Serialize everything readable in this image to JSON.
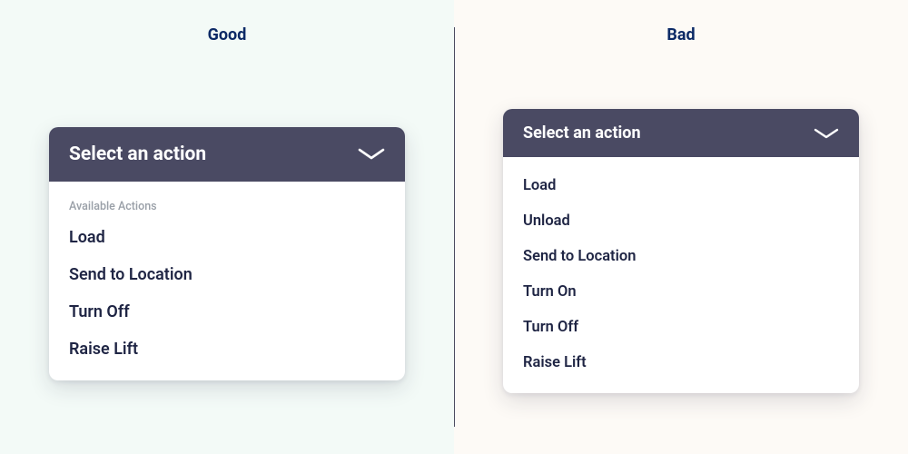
{
  "good": {
    "title": "Good",
    "dropdown": {
      "placeholder": "Select an action",
      "section_label": "Available Actions",
      "items": [
        {
          "label": "Load"
        },
        {
          "label": "Send to Location"
        },
        {
          "label": "Turn Off"
        },
        {
          "label": "Raise Lift"
        }
      ]
    }
  },
  "bad": {
    "title": "Bad",
    "dropdown": {
      "placeholder": "Select an action",
      "items": [
        {
          "label": "Load"
        },
        {
          "label": "Unload"
        },
        {
          "label": "Send to Location"
        },
        {
          "label": "Turn On"
        },
        {
          "label": "Turn Off"
        },
        {
          "label": "Raise Lift"
        }
      ]
    }
  }
}
